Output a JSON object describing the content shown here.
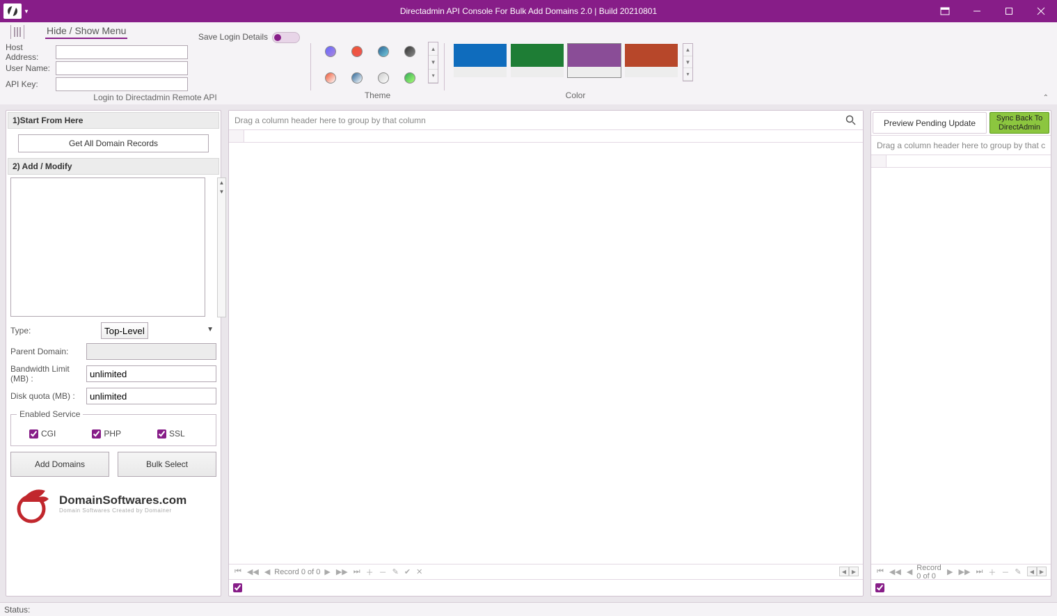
{
  "window": {
    "title": "Directadmin API Console For Bulk Add Domains 2.0 | Build 20210801"
  },
  "ribbon": {
    "hide_show": "Hide / Show Menu",
    "login": {
      "caption": "Login to Directadmin Remote API",
      "host_label": "Host Address:",
      "host_value": "",
      "user_label": "User Name:",
      "user_value": "",
      "key_label": "API Key:",
      "key_value": "",
      "save_login_label": "Save Login Details"
    },
    "theme": {
      "caption": "Theme"
    },
    "color": {
      "caption": "Color"
    }
  },
  "sections": {
    "start_header": "1)Start From Here",
    "get_all_btn": "Get All Domain Records",
    "addmod_header": "2) Add / Modify",
    "domains_text": "",
    "type_label": "Type:",
    "type_value": "Top-Level",
    "parent_label": "Parent Domain:",
    "parent_value": "",
    "bw_label": "Bandwidth Limit (MB) :",
    "bw_value": "unlimited",
    "disk_label": "Disk quota (MB) :",
    "disk_value": "unlimited",
    "enabled_legend": "Enabled Service",
    "cgi_label": "CGI",
    "php_label": "PHP",
    "ssl_label": "SSL",
    "add_btn": "Add Domains",
    "bulk_btn": "Bulk Select",
    "logo_text": "DomainSoftwares.com",
    "logo_sub": "Domain Softwares Created by Domainer"
  },
  "mid_grid": {
    "group_hint": "Drag a column header here to group by that column",
    "record_text": "Record 0 of 0"
  },
  "right": {
    "preview_label": "Preview Pending Update",
    "sync_label": "Sync Back To DirectAdmin",
    "group_hint": "Drag a column header here to group by that column",
    "record_text": "Record 0 of 0"
  },
  "statusbar": {
    "label": "Status:"
  }
}
